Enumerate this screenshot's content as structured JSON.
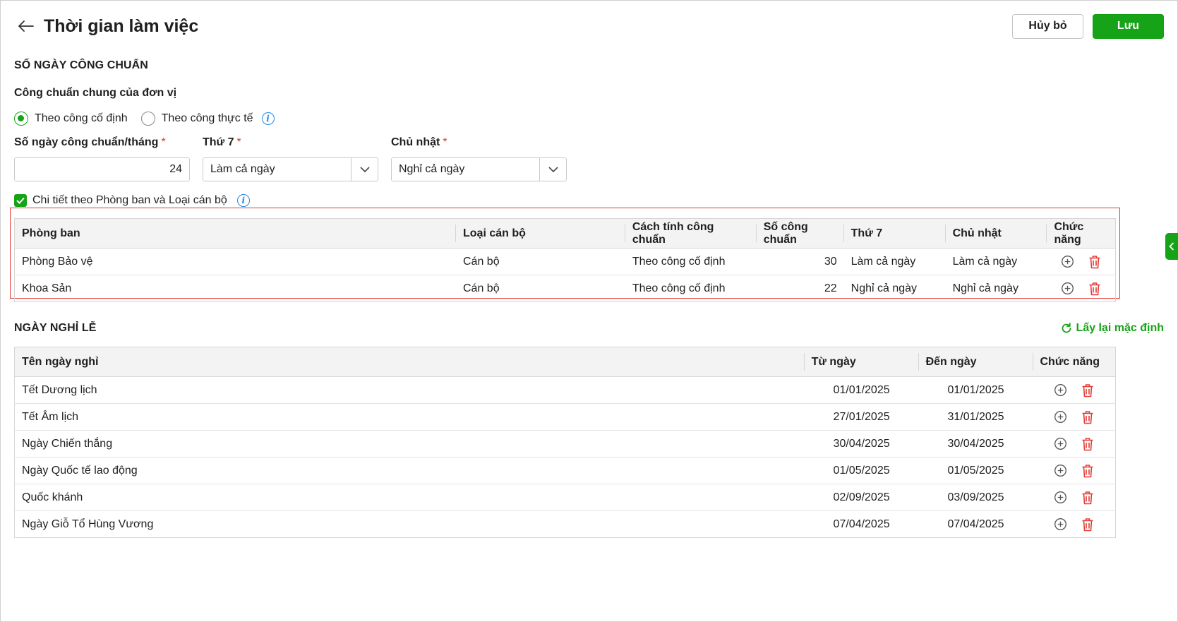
{
  "header": {
    "title": "Thời gian làm việc",
    "cancel_label": "Hủy bỏ",
    "save_label": "Lưu"
  },
  "standard": {
    "section_title": "SỐ NGÀY CÔNG CHUẨN",
    "sub_title": "Công chuẩn chung của đơn vị",
    "radio_fixed": "Theo công cố định",
    "radio_actual": "Theo công thực tế",
    "selected_radio": "Theo công cố định",
    "days_label": "Số ngày công chuẩn/tháng",
    "days_value": "24",
    "saturday_label": "Thứ 7",
    "saturday_value": "Làm cả ngày",
    "sunday_label": "Chủ nhật",
    "sunday_value": "Nghỉ cả ngày",
    "required_mark": "*",
    "detail_checkbox_label": "Chi tiết theo Phòng ban và Loại cán bộ",
    "detail_checked": true
  },
  "dept_table": {
    "headers": [
      "Phòng ban",
      "Loại cán bộ",
      "Cách tính công chuẩn",
      "Số công chuẩn",
      "Thứ 7",
      "Chủ nhật",
      "Chức năng"
    ],
    "rows": [
      [
        "Phòng Bảo vệ",
        "Cán bộ",
        "Theo công cố định",
        "30",
        "Làm cả ngày",
        "Làm cả ngày"
      ],
      [
        "Khoa Sản",
        "Cán bộ",
        "Theo công cố định",
        "22",
        "Nghỉ cả ngày",
        "Nghỉ cả ngày"
      ]
    ]
  },
  "holidays": {
    "section_title": "NGÀY NGHỈ LỄ",
    "reset_label": "Lấy lại mặc định",
    "headers": [
      "Tên ngày nghỉ",
      "Từ ngày",
      "Đến ngày",
      "Chức năng"
    ],
    "rows": [
      [
        "Tết Dương lịch",
        "01/01/2025",
        "01/01/2025"
      ],
      [
        "Tết Âm lịch",
        "27/01/2025",
        "31/01/2025"
      ],
      [
        "Ngày Chiến thắng",
        "30/04/2025",
        "30/04/2025"
      ],
      [
        "Ngày Quốc tế lao động",
        "01/05/2025",
        "01/05/2025"
      ],
      [
        "Quốc khánh",
        "02/09/2025",
        "03/09/2025"
      ],
      [
        "Ngày Giỗ Tổ Hùng Vương",
        "07/04/2025",
        "07/04/2025"
      ]
    ]
  },
  "colors": {
    "accent": "#17a317",
    "danger": "#e53935",
    "info": "#1e88e5"
  },
  "icons": {
    "back": "arrow-left-icon",
    "info": "info-icon",
    "add": "plus-circle-icon",
    "delete": "trash-icon",
    "reset": "refresh-icon",
    "dropdown": "chevron-down-icon",
    "side": "chevron-left-icon"
  }
}
